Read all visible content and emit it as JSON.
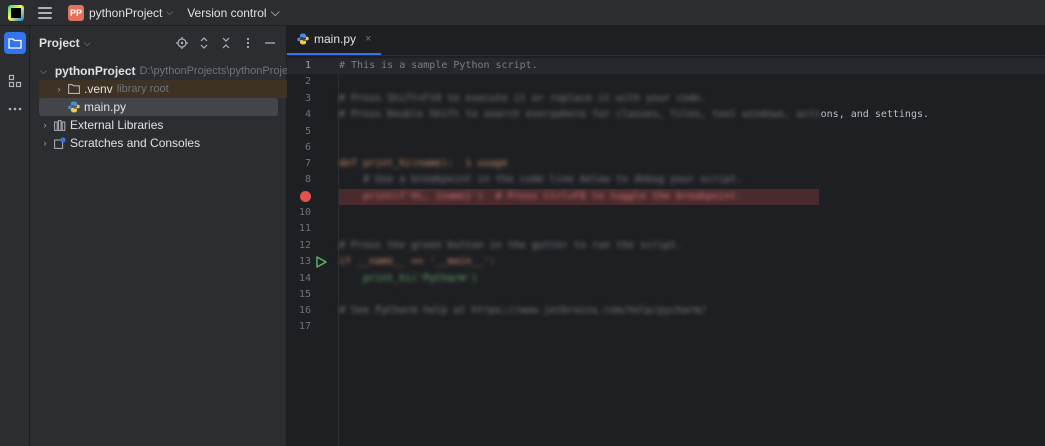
{
  "titlebar": {
    "project_badge": "PP",
    "project_name": "pythonProject",
    "vcs_label": "Version control"
  },
  "toolstrip": {
    "items": [
      {
        "icon": "folder-icon",
        "active": true
      },
      {
        "icon": "structure-icon",
        "active": false
      },
      {
        "icon": "more-icon",
        "active": false
      }
    ]
  },
  "project_panel": {
    "title": "Project",
    "tree": [
      {
        "name": "pythonProject",
        "extra": "D:\\pythonProjects\\pythonProject",
        "icon": "folder-icon",
        "expanded": true
      },
      {
        "name": ".venv",
        "extra": "library root",
        "icon": "folder-icon",
        "expanded": false
      },
      {
        "name": "main.py",
        "extra": "",
        "icon": "python-file-icon",
        "selected": true
      },
      {
        "name": "External Libraries",
        "extra": "",
        "icon": "libraries-icon",
        "expanded": false
      },
      {
        "name": "Scratches and Consoles",
        "extra": "",
        "icon": "scratches-icon",
        "expanded": false
      }
    ]
  },
  "editor": {
    "tab_label": "main.py",
    "close_glyph": "×",
    "line_numbers": [
      "1",
      "2",
      "3",
      "4",
      "5",
      "6",
      "7",
      "8",
      "9",
      "10",
      "11",
      "12",
      "13",
      "14",
      "15",
      "16",
      "17"
    ],
    "line1": "# This is a sample Python script.",
    "line3": "# Press Shift+F10 to execute it or replace it with your code.",
    "line4_blurred": "# Press Double Shift to search everywhere for classes, files, tool windows, acti",
    "line4_visible": "ons, and settings.",
    "line7": "def print_hi(name):  1 usage",
    "line8": "    # Use a breakpoint in the code line below to debug your script.",
    "line9": "    print(f'Hi, {name}')  # Press Ctrl+F8 to toggle the breakpoint.",
    "line12": "# Press the green button in the gutter to run the script.",
    "line13": "if __name__ == '__main__':",
    "line14": "    print_hi('PyCharm')",
    "line16": "# See PyCharm help at https://www.jetbrains.com/help/pycharm/"
  },
  "colors": {
    "accent": "#3574f0",
    "breakpoint": "#e35252",
    "run": "#5fb865"
  }
}
